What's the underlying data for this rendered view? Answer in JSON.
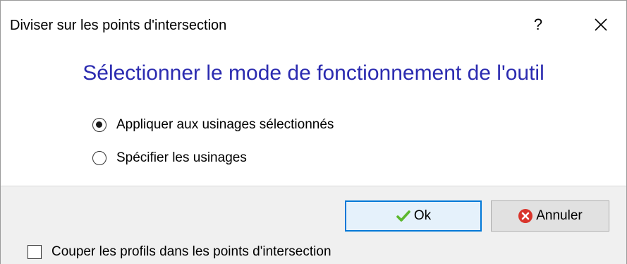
{
  "window": {
    "title": "Diviser sur les points d'intersection",
    "help_label": "?"
  },
  "content": {
    "heading": "Sélectionner le mode de fonctionnement de l'outil",
    "options": [
      {
        "label": "Appliquer aux usinages sélectionnés",
        "selected": true
      },
      {
        "label": "Spécifier les usinages",
        "selected": false
      }
    ]
  },
  "footer": {
    "ok_label": "Ok",
    "cancel_label": "Annuler",
    "checkbox_label": "Couper les profils dans les points d'intersection",
    "checkbox_checked": false
  },
  "colors": {
    "heading": "#2b2bb0",
    "ok_border": "#0078d7",
    "ok_icon": "#5cb82e",
    "cancel_icon": "#d9342b"
  },
  "icons": {
    "ok": "checkmark-icon",
    "cancel": "cancel-icon",
    "close": "close-icon"
  }
}
